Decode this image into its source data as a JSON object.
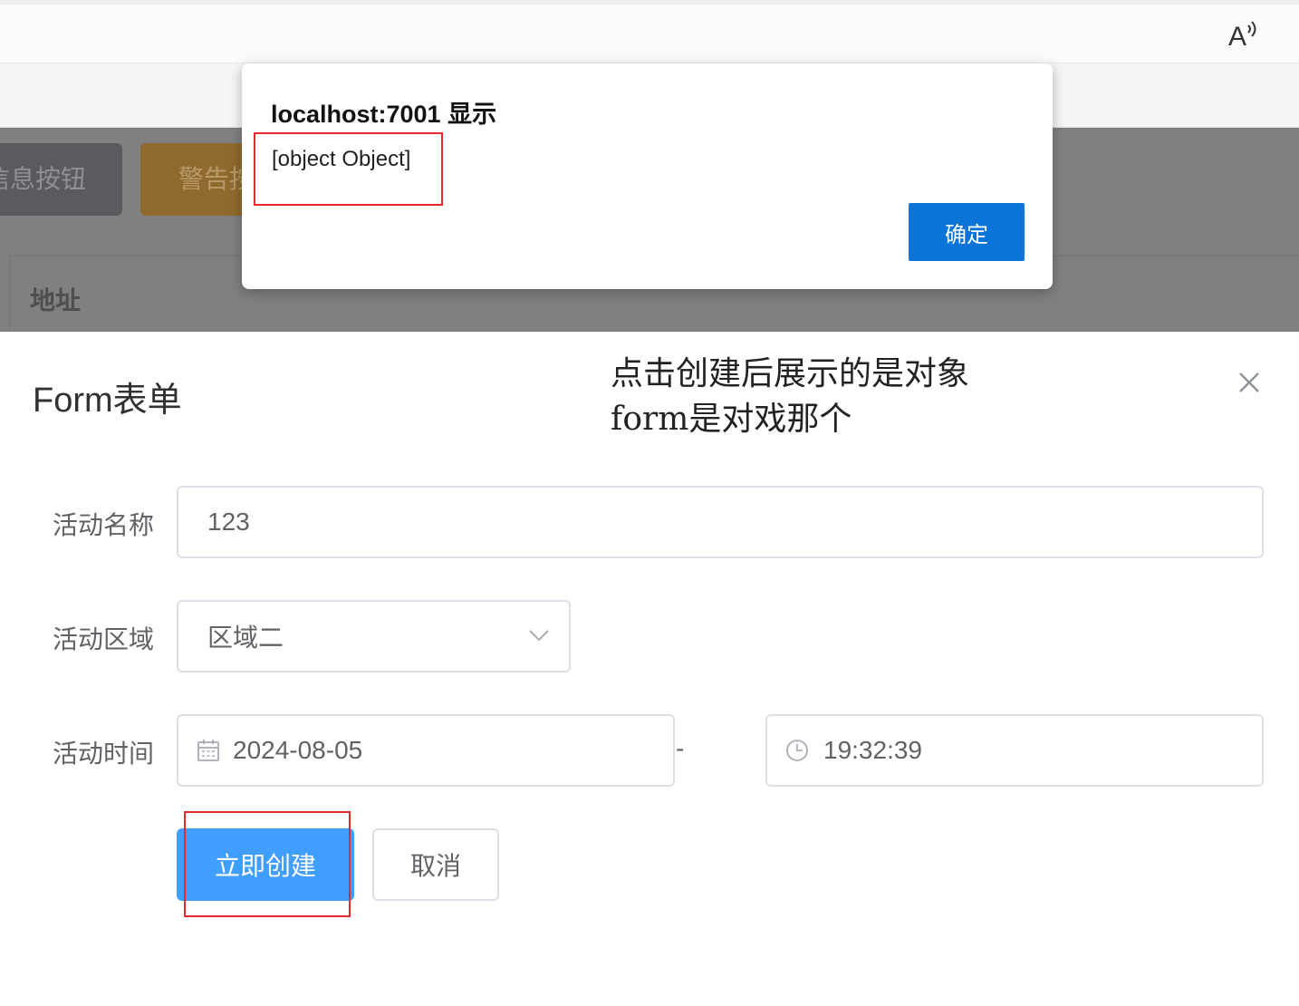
{
  "alert": {
    "title": "localhost:7001 显示",
    "message": "[object Object]",
    "ok_label": "确定"
  },
  "background_page": {
    "info_button_label": "信息按钮",
    "warning_button_label": "警告按钮",
    "table_header_address": "地址"
  },
  "annotation": {
    "line1": "点击创建后展示的是对象",
    "line2": "form是对戏那个"
  },
  "form": {
    "title": "Form表单",
    "name_label": "活动名称",
    "name_value": "123",
    "region_label": "活动区域",
    "region_value": "区域二",
    "time_label": "活动时间",
    "date_value": "2024-08-05",
    "separator": "-",
    "time_value": "19:32:39",
    "submit_label": "立即创建",
    "cancel_label": "取消"
  },
  "colors": {
    "primary": "#409eff",
    "alert_button": "#0a74d8",
    "annotation_red": "#e8282b"
  }
}
